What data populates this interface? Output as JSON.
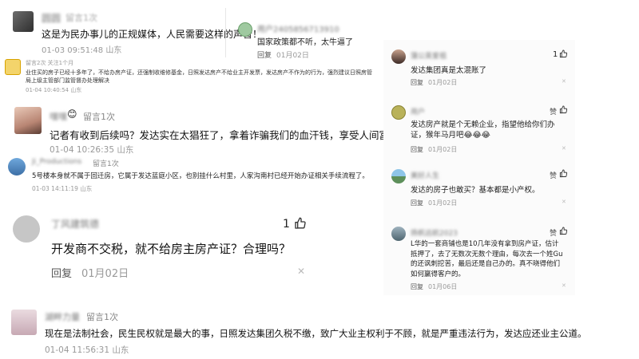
{
  "c1": {
    "username": "圆圆",
    "badge": "留言1次",
    "text": "这是为民办事儿的正规媒体，人民需要这样的声音！",
    "meta": "01-03 09:51:48 山东"
  },
  "c2": {
    "username": "用户2405856713910",
    "text": "国家政策都不听，太牛逼了",
    "reply": "回复",
    "date": "01月02日"
  },
  "c3": {
    "username": "",
    "badge": "留言2次 关注1个月",
    "text": "业住买的房子已经十多年了，不给办房产证，还强制收维修基金，日照发达房产不给业主开发票，发达房产不作为的行为，强烈建议日照房管局上级主管部门监管督办处理解决",
    "meta": "01-04 10:40:54 山东"
  },
  "c4": {
    "username": "嘿嘿",
    "badge": "留言1次",
    "text": "记者有收到后续吗？发达实在太猖狂了，拿着诈骗我们的血汗钱，享受人间富贵",
    "meta": "01-04 10:26:35 山东"
  },
  "c5": {
    "username": "Ji_Productions",
    "badge": "留言1次",
    "text": "5号楼本身就不属于回迁房，它属于发达蓝庭小区，也别挂什么村里，人家沟南村已经开始办证相关手续流程了。",
    "meta": "01-03 14:11:19 山东"
  },
  "c6": {
    "username": "丁风建筑德",
    "likes": "1",
    "text": "开发商不交税，就不给房主房产证？合理吗？",
    "reply": "回复",
    "date": "01月02日"
  },
  "c7": {
    "username": "湖畔力量",
    "badge": "留言1次",
    "text": "现在是法制社会，民生民权就是最大的事，日照发达集团久税不缴，致广大业主权利于不顾，就是严重违法行为，发达应还业主公道。",
    "meta": "01-04 11:56:31 山东"
  },
  "r1": {
    "username": "蒲公英爱祖",
    "likes": "1",
    "text": "发达集团真是太混账了",
    "reply": "回复",
    "date": "01月02日"
  },
  "r2": {
    "username": "用户",
    "likes": "赞",
    "text": "发达房产就是个无赖企业，指望他给你们办证，猴年马月吧😂😂😂",
    "reply": "回复",
    "date": "01月02日"
  },
  "r3": {
    "username": "美好人生",
    "likes": "赞",
    "text": "发达的房子也敢买？基本都是小产权。",
    "reply": "回复",
    "date": "01月02日"
  },
  "r4": {
    "username": "扬帆远航2023",
    "likes": "赞",
    "text": "L华的一套商铺也是10几年没有拿到房产证，估计抵押了，去了无数次无数个理由，每次去一个姓Gu的还讽刺挖苦，最后还是自己办的。真不晓得他们如何赢得客户的。",
    "reply": "回复",
    "date": "01月06日"
  }
}
